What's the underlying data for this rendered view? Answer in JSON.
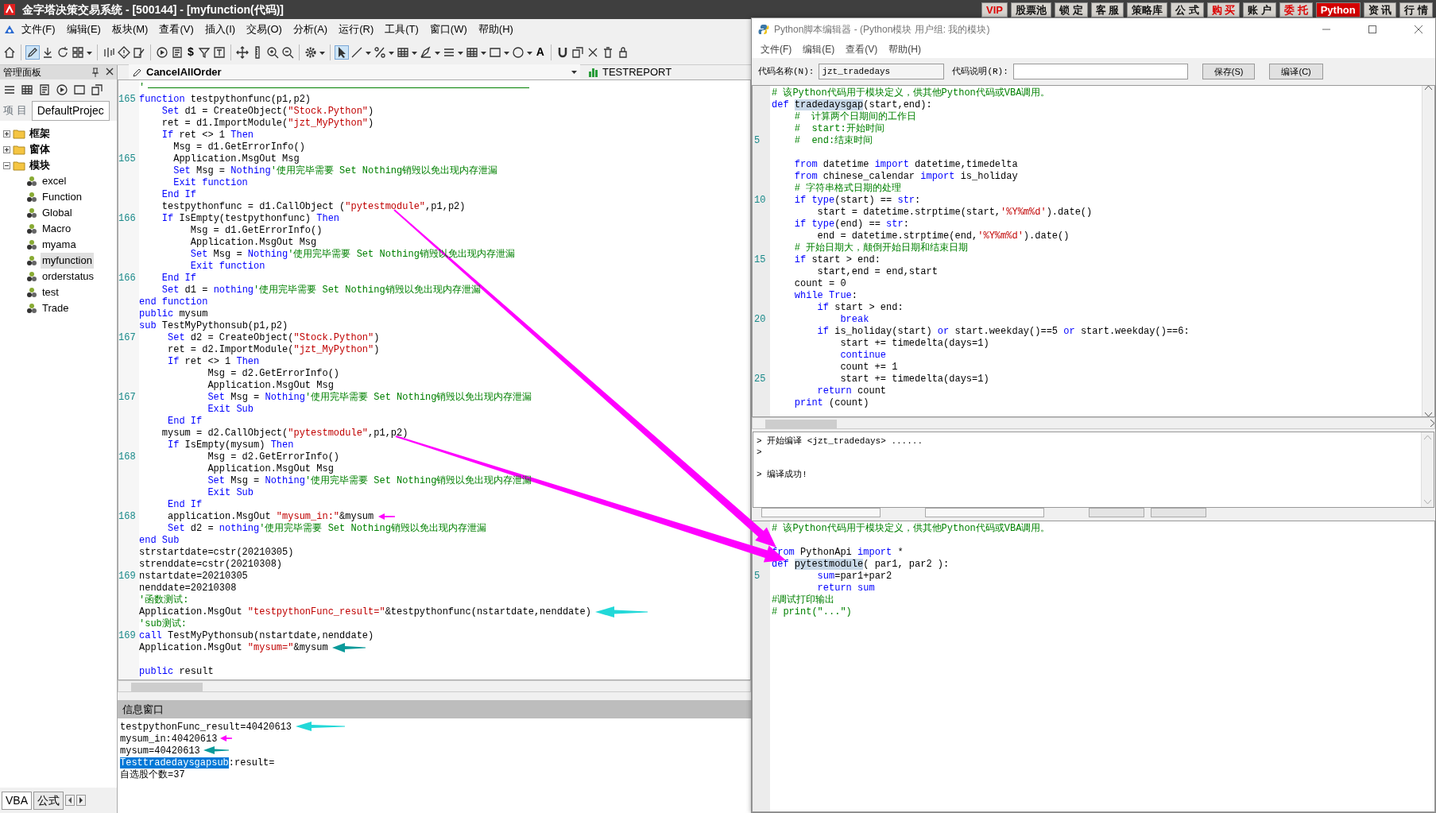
{
  "window": {
    "title": "金字塔决策交易系统 - [500144] - [myfunction(代码)]"
  },
  "title_buttons": [
    {
      "label": "VIP",
      "kind": "red"
    },
    {
      "label": "股票池",
      "kind": "plain"
    },
    {
      "label": "锁 定",
      "kind": "plain"
    },
    {
      "label": "客 服",
      "kind": "plain"
    },
    {
      "label": "策略库",
      "kind": "plain"
    },
    {
      "label": "公 式",
      "kind": "plain"
    },
    {
      "label": "购 买",
      "kind": "red"
    },
    {
      "label": "账 户",
      "kind": "plain"
    },
    {
      "label": "委 托",
      "kind": "red"
    },
    {
      "label": "Python",
      "kind": "filled"
    },
    {
      "label": "资 讯",
      "kind": "plain"
    },
    {
      "label": "行 情",
      "kind": "plain"
    }
  ],
  "menu": [
    "文件(F)",
    "编辑(E)",
    "板块(M)",
    "查看(V)",
    "插入(I)",
    "交易(O)",
    "分析(A)",
    "运行(R)",
    "工具(T)",
    "窗口(W)",
    "帮助(H)"
  ],
  "toolbar": {
    "currency": "$",
    "text_tool": "A"
  },
  "manage_panel": {
    "title": "管理面板",
    "project_label": "项 目",
    "project_tab": "DefaultProjec",
    "tree": [
      {
        "label": "框架",
        "expanded": false,
        "selected": false
      },
      {
        "label": "窗体",
        "expanded": false,
        "selected": false
      },
      {
        "label": "模块",
        "expanded": true,
        "selected": false,
        "children": [
          {
            "label": "excel",
            "selected": false
          },
          {
            "label": "Function",
            "selected": false
          },
          {
            "label": "Global",
            "selected": false
          },
          {
            "label": "Macro",
            "selected": false
          },
          {
            "label": "myama",
            "selected": false
          },
          {
            "label": "myfunction",
            "selected": true
          },
          {
            "label": "orderstatus",
            "selected": false
          },
          {
            "label": "test",
            "selected": false
          },
          {
            "label": "Trade",
            "selected": false
          }
        ]
      }
    ],
    "bottom_tabs": [
      {
        "label": "VBA",
        "selected": true
      },
      {
        "label": "公式",
        "selected": false
      }
    ]
  },
  "editor": {
    "module_selector": "CancelAllOrder",
    "report_tab": "TESTREPORT",
    "lines": [
      {
        "segs": [
          {
            "kind": "comment",
            "text": "'"
          }
        ]
      },
      {
        "num": "165",
        "segs": [
          {
            "kind": "keyword",
            "text": "function"
          },
          {
            "kind": "plain",
            "text": " testpythonfunc(p1,p2)"
          }
        ]
      },
      {
        "segs": [
          {
            "kind": "keyword",
            "text": "    Set"
          },
          {
            "kind": "plain",
            "text": " d1 = CreateObject("
          },
          {
            "kind": "string",
            "text": "\"Stock.Python\""
          },
          {
            "kind": "plain",
            "text": ")"
          }
        ]
      },
      {
        "segs": [
          {
            "kind": "plain",
            "text": "    ret = d1.ImportModule("
          },
          {
            "kind": "string",
            "text": "\"jzt_MyPython\""
          },
          {
            "kind": "plain",
            "text": ")"
          }
        ]
      },
      {
        "segs": [
          {
            "kind": "keyword",
            "text": "    If"
          },
          {
            "kind": "plain",
            "text": " ret <> 1 "
          },
          {
            "kind": "keyword",
            "text": "Then"
          }
        ]
      },
      {
        "segs": [
          {
            "kind": "plain",
            "text": "      Msg = d1.GetErrorInfo()"
          }
        ]
      },
      {
        "num": "165",
        "segs": [
          {
            "kind": "plain",
            "text": "      Application.MsgOut Msg"
          }
        ]
      },
      {
        "segs": [
          {
            "kind": "keyword",
            "text": "      Set"
          },
          {
            "kind": "plain",
            "text": " Msg = "
          },
          {
            "kind": "keyword",
            "text": "Nothing"
          },
          {
            "kind": "comment",
            "text": "'使用完毕需要 Set Nothing销毁以免出现内存泄漏"
          }
        ]
      },
      {
        "segs": [
          {
            "kind": "keyword",
            "text": "      Exit function"
          }
        ]
      },
      {
        "segs": [
          {
            "kind": "keyword",
            "text": "    End If"
          }
        ]
      },
      {
        "segs": [
          {
            "kind": "plain",
            "text": "    testpythonfunc = d1.CallObject ("
          },
          {
            "kind": "string",
            "text": "\"pytestmodule\""
          },
          {
            "kind": "plain",
            "text": ",p1,p2)"
          }
        ]
      },
      {
        "num": "166",
        "segs": [
          {
            "kind": "keyword",
            "text": "    If"
          },
          {
            "kind": "plain",
            "text": " IsEmpty(testpythonfunc) "
          },
          {
            "kind": "keyword",
            "text": "Then"
          }
        ]
      },
      {
        "segs": [
          {
            "kind": "plain",
            "text": "         Msg = d1.GetErrorInfo()"
          }
        ]
      },
      {
        "segs": [
          {
            "kind": "plain",
            "text": "         Application.MsgOut Msg"
          }
        ]
      },
      {
        "segs": [
          {
            "kind": "keyword",
            "text": "         Set"
          },
          {
            "kind": "plain",
            "text": " Msg = "
          },
          {
            "kind": "keyword",
            "text": "Nothing"
          },
          {
            "kind": "comment",
            "text": "'使用完毕需要 Set Nothing销毁以免出现内存泄漏"
          }
        ]
      },
      {
        "segs": [
          {
            "kind": "keyword",
            "text": "         Exit function"
          }
        ]
      },
      {
        "num": "166",
        "segs": [
          {
            "kind": "keyword",
            "text": "    End If"
          }
        ]
      },
      {
        "segs": [
          {
            "kind": "keyword",
            "text": "    Set"
          },
          {
            "kind": "plain",
            "text": " d1 = "
          },
          {
            "kind": "keyword",
            "text": "nothing"
          },
          {
            "kind": "comment",
            "text": "'使用完毕需要 Set Nothing销毁以免出现内存泄漏"
          }
        ]
      },
      {
        "segs": [
          {
            "kind": "keyword",
            "text": "end function"
          }
        ]
      },
      {
        "segs": [
          {
            "kind": "keyword",
            "text": "public"
          },
          {
            "kind": "plain",
            "text": " mysum"
          }
        ]
      },
      {
        "segs": [
          {
            "kind": "keyword",
            "text": "sub"
          },
          {
            "kind": "plain",
            "text": " TestMyPythonsub(p1,p2)"
          }
        ]
      },
      {
        "num": "167",
        "segs": [
          {
            "kind": "keyword",
            "text": "     Set"
          },
          {
            "kind": "plain",
            "text": " d2 = CreateObject("
          },
          {
            "kind": "string",
            "text": "\"Stock.Python\""
          },
          {
            "kind": "plain",
            "text": ")"
          }
        ]
      },
      {
        "segs": [
          {
            "kind": "plain",
            "text": "     ret = d2.ImportModule("
          },
          {
            "kind": "string",
            "text": "\"jzt_MyPython\""
          },
          {
            "kind": "plain",
            "text": ")"
          }
        ]
      },
      {
        "segs": [
          {
            "kind": "keyword",
            "text": "     If"
          },
          {
            "kind": "plain",
            "text": " ret <> 1 "
          },
          {
            "kind": "keyword",
            "text": "Then"
          }
        ]
      },
      {
        "segs": [
          {
            "kind": "plain",
            "text": "            Msg = d2.GetErrorInfo()"
          }
        ]
      },
      {
        "segs": [
          {
            "kind": "plain",
            "text": "            Application.MsgOut Msg"
          }
        ]
      },
      {
        "num": "167",
        "segs": [
          {
            "kind": "keyword",
            "text": "            Set"
          },
          {
            "kind": "plain",
            "text": " Msg = "
          },
          {
            "kind": "keyword",
            "text": "Nothing"
          },
          {
            "kind": "comment",
            "text": "'使用完毕需要 Set Nothing销毁以免出现内存泄漏"
          }
        ]
      },
      {
        "segs": [
          {
            "kind": "keyword",
            "text": "            Exit Sub"
          }
        ]
      },
      {
        "segs": [
          {
            "kind": "keyword",
            "text": "     End If"
          }
        ]
      },
      {
        "segs": [
          {
            "kind": "plain",
            "text": "    mysum = d2.CallObject("
          },
          {
            "kind": "string",
            "text": "\"pytestmodule\""
          },
          {
            "kind": "plain",
            "text": ",p1,p2)"
          }
        ]
      },
      {
        "segs": [
          {
            "kind": "keyword",
            "text": "     If"
          },
          {
            "kind": "plain",
            "text": " IsEmpty(mysum) "
          },
          {
            "kind": "keyword",
            "text": "Then"
          }
        ]
      },
      {
        "num": "168",
        "segs": [
          {
            "kind": "plain",
            "text": "            Msg = d2.GetErrorInfo()"
          }
        ]
      },
      {
        "segs": [
          {
            "kind": "plain",
            "text": "            Application.MsgOut Msg"
          }
        ]
      },
      {
        "segs": [
          {
            "kind": "keyword",
            "text": "            Set"
          },
          {
            "kind": "plain",
            "text": " Msg = "
          },
          {
            "kind": "keyword",
            "text": "Nothing"
          },
          {
            "kind": "comment",
            "text": "'使用完毕需要 Set Nothing销毁以免出现内存泄漏"
          }
        ]
      },
      {
        "segs": [
          {
            "kind": "keyword",
            "text": "            Exit Sub"
          }
        ]
      },
      {
        "segs": [
          {
            "kind": "keyword",
            "text": "     End If"
          }
        ]
      },
      {
        "num": "168",
        "segs": [
          {
            "kind": "plain",
            "text": "     application.MsgOut "
          },
          {
            "kind": "string",
            "text": "\"mysum_in:\""
          },
          {
            "kind": "plain",
            "text": "&mysum"
          }
        ]
      },
      {
        "segs": [
          {
            "kind": "keyword",
            "text": "     Set"
          },
          {
            "kind": "plain",
            "text": " d2 = "
          },
          {
            "kind": "keyword",
            "text": "nothing"
          },
          {
            "kind": "comment",
            "text": "'使用完毕需要 Set Nothing销毁以免出现内存泄漏"
          }
        ]
      },
      {
        "segs": [
          {
            "kind": "keyword",
            "text": "end Sub"
          }
        ]
      },
      {
        "segs": [
          {
            "kind": "plain",
            "text": "strstartdate=cstr(20210305)"
          }
        ]
      },
      {
        "segs": [
          {
            "kind": "plain",
            "text": "strenddate=cstr(20210308)"
          }
        ]
      },
      {
        "num": "169",
        "segs": [
          {
            "kind": "plain",
            "text": "nstartdate=20210305"
          }
        ]
      },
      {
        "segs": [
          {
            "kind": "plain",
            "text": "nenddate=20210308"
          }
        ]
      },
      {
        "segs": [
          {
            "kind": "comment",
            "text": "'函数测试:"
          }
        ]
      },
      {
        "segs": [
          {
            "kind": "plain",
            "text": "Application.MsgOut "
          },
          {
            "kind": "string",
            "text": "\"testpythonFunc_result=\""
          },
          {
            "kind": "plain",
            "text": "&testpythonfunc(nstartdate,nenddate)"
          }
        ]
      },
      {
        "segs": [
          {
            "kind": "comment",
            "text": "'sub测试:"
          }
        ]
      },
      {
        "num": "169",
        "segs": [
          {
            "kind": "keyword",
            "text": "call"
          },
          {
            "kind": "plain",
            "text": " TestMyPythonsub(nstartdate,nenddate)"
          }
        ]
      },
      {
        "segs": [
          {
            "kind": "plain",
            "text": "Application.MsgOut "
          },
          {
            "kind": "string",
            "text": "\"mysum=\""
          },
          {
            "kind": "plain",
            "text": "&mysum"
          }
        ]
      },
      {
        "gap_before": true,
        "segs": [
          {
            "kind": "keyword",
            "text": "public"
          },
          {
            "kind": "plain",
            "text": " result"
          }
        ]
      }
    ]
  },
  "info_window": {
    "title": "信息窗口",
    "lines": [
      {
        "segs": [
          {
            "kind": "plain",
            "text": "testpythonFunc_result=40420613"
          }
        ]
      },
      {
        "segs": [
          {
            "kind": "plain",
            "text": "mysum_in:40420613"
          }
        ]
      },
      {
        "segs": [
          {
            "kind": "plain",
            "text": "mysum=40420613"
          }
        ]
      },
      {
        "segs": [
          {
            "kind": "selection",
            "text": "Testtradedaysgapsub"
          },
          {
            "kind": "plain",
            "text": ":result="
          }
        ]
      },
      {
        "segs": [
          {
            "kind": "plain",
            "text": "自选股个数=37"
          }
        ]
      }
    ]
  },
  "python_editor": {
    "title": "Python脚本编辑器 - (Python模块 用户组: 我的模块)",
    "menu": [
      "文件(F)",
      "编辑(E)",
      "查看(V)",
      "帮助(H)"
    ],
    "name_label": "代码名称(N):",
    "name_value": "jzt_tradedays",
    "desc_label": "代码说明(R):",
    "buttons": [
      "保存(S)",
      "编译(C)"
    ],
    "lines": [
      {
        "segs": [
          {
            "kind": "comment",
            "text": "# 该Python代码用于模块定义，供其他Python代码或VBA调用。"
          }
        ]
      },
      {
        "segs": [
          {
            "kind": "keyword",
            "text": "def "
          },
          {
            "kind": "highlight",
            "text": "tradedaysgap"
          },
          {
            "kind": "plain",
            "text": "(start,end):"
          }
        ]
      },
      {
        "segs": [
          {
            "kind": "comment",
            "text": "    #  计算两个日期间的工作日"
          }
        ]
      },
      {
        "segs": [
          {
            "kind": "comment",
            "text": "    #  start:开始时间"
          }
        ]
      },
      {
        "num": "5",
        "segs": [
          {
            "kind": "comment",
            "text": "    #  end:结束时间"
          }
        ]
      },
      {
        "gap_before": true,
        "segs": [
          {
            "kind": "keyword",
            "text": "    from"
          },
          {
            "kind": "plain",
            "text": " datetime "
          },
          {
            "kind": "keyword",
            "text": "import"
          },
          {
            "kind": "plain",
            "text": " datetime,timedelta"
          }
        ]
      },
      {
        "segs": [
          {
            "kind": "keyword",
            "text": "    from"
          },
          {
            "kind": "plain",
            "text": " chinese_calendar "
          },
          {
            "kind": "keyword",
            "text": "import"
          },
          {
            "kind": "plain",
            "text": " is_holiday"
          }
        ]
      },
      {
        "segs": [
          {
            "kind": "comment",
            "text": "    # 字符串格式日期的处理"
          }
        ]
      },
      {
        "num": "10",
        "segs": [
          {
            "kind": "keyword",
            "text": "    if type"
          },
          {
            "kind": "plain",
            "text": "(start) == "
          },
          {
            "kind": "keyword",
            "text": "str"
          },
          {
            "kind": "plain",
            "text": ":"
          }
        ]
      },
      {
        "segs": [
          {
            "kind": "plain",
            "text": "        start = datetime.strptime(start,"
          },
          {
            "kind": "string",
            "text": "'%Y%m%d'"
          },
          {
            "kind": "plain",
            "text": ").date()"
          }
        ]
      },
      {
        "segs": [
          {
            "kind": "keyword",
            "text": "    if type"
          },
          {
            "kind": "plain",
            "text": "(end) == "
          },
          {
            "kind": "keyword",
            "text": "str"
          },
          {
            "kind": "plain",
            "text": ":"
          }
        ]
      },
      {
        "segs": [
          {
            "kind": "plain",
            "text": "        end = datetime.strptime(end,"
          },
          {
            "kind": "string",
            "text": "'%Y%m%d'"
          },
          {
            "kind": "plain",
            "text": ").date()"
          }
        ]
      },
      {
        "segs": [
          {
            "kind": "comment",
            "text": "    # 开始日期大，颠倒开始日期和结束日期"
          }
        ]
      },
      {
        "num": "15",
        "segs": [
          {
            "kind": "keyword",
            "text": "    if"
          },
          {
            "kind": "plain",
            "text": " start > end:"
          }
        ]
      },
      {
        "segs": [
          {
            "kind": "plain",
            "text": "        start,end = end,start"
          }
        ]
      },
      {
        "segs": [
          {
            "kind": "plain",
            "text": "    count = 0"
          }
        ]
      },
      {
        "segs": [
          {
            "kind": "keyword",
            "text": "    while True"
          },
          {
            "kind": "plain",
            "text": ":"
          }
        ]
      },
      {
        "segs": [
          {
            "kind": "keyword",
            "text": "        if"
          },
          {
            "kind": "plain",
            "text": " start > end:"
          }
        ]
      },
      {
        "num": "20",
        "segs": [
          {
            "kind": "keyword",
            "text": "            break"
          }
        ]
      },
      {
        "segs": [
          {
            "kind": "keyword",
            "text": "        if"
          },
          {
            "kind": "plain",
            "text": " is_holiday(start) "
          },
          {
            "kind": "keyword",
            "text": "or"
          },
          {
            "kind": "plain",
            "text": " start.weekday()==5 "
          },
          {
            "kind": "keyword",
            "text": "or"
          },
          {
            "kind": "plain",
            "text": " start.weekday()==6:"
          }
        ]
      },
      {
        "segs": [
          {
            "kind": "plain",
            "text": "            start += timedelta(days=1)"
          }
        ]
      },
      {
        "segs": [
          {
            "kind": "keyword",
            "text": "            continue"
          }
        ]
      },
      {
        "segs": [
          {
            "kind": "plain",
            "text": "            count += 1"
          }
        ]
      },
      {
        "num": "25",
        "segs": [
          {
            "kind": "plain",
            "text": "            start += timedelta(days=1)"
          }
        ]
      },
      {
        "segs": [
          {
            "kind": "keyword",
            "text": "        return"
          },
          {
            "kind": "plain",
            "text": " count"
          }
        ]
      },
      {
        "segs": [
          {
            "kind": "keyword",
            "text": "    print"
          },
          {
            "kind": "plain",
            "text": " (count)"
          }
        ]
      }
    ],
    "output": [
      {
        "text": "> 开始编译 <jzt_tradedays> ......"
      },
      {
        "text": ">"
      },
      {
        "text": "> 编译成功!",
        "gap_before": true
      }
    ],
    "second_lines": [
      {
        "segs": [
          {
            "kind": "comment",
            "text": "# 该Python代码用于模块定义，供其他Python代码或VBA调用。"
          }
        ]
      },
      {
        "gap_before": true,
        "segs": [
          {
            "kind": "keyword",
            "text": "from"
          },
          {
            "kind": "plain",
            "text": " PythonApi "
          },
          {
            "kind": "keyword",
            "text": "import"
          },
          {
            "kind": "plain",
            "text": " *"
          }
        ]
      },
      {
        "segs": [
          {
            "kind": "keyword",
            "text": "def "
          },
          {
            "kind": "highlight",
            "text": "pytestmodule"
          },
          {
            "kind": "plain",
            "text": "( par1, par2 ):"
          }
        ]
      },
      {
        "num": "5",
        "segs": [
          {
            "kind": "keyword",
            "text": "        sum"
          },
          {
            "kind": "plain",
            "text": "=par1+par2"
          }
        ]
      },
      {
        "segs": [
          {
            "kind": "keyword",
            "text": "        return sum"
          }
        ]
      },
      {
        "segs": [
          {
            "kind": "comment",
            "text": "#调试打印输出"
          }
        ]
      },
      {
        "segs": [
          {
            "kind": "comment",
            "text": "# print(\"...\")"
          }
        ]
      }
    ]
  }
}
